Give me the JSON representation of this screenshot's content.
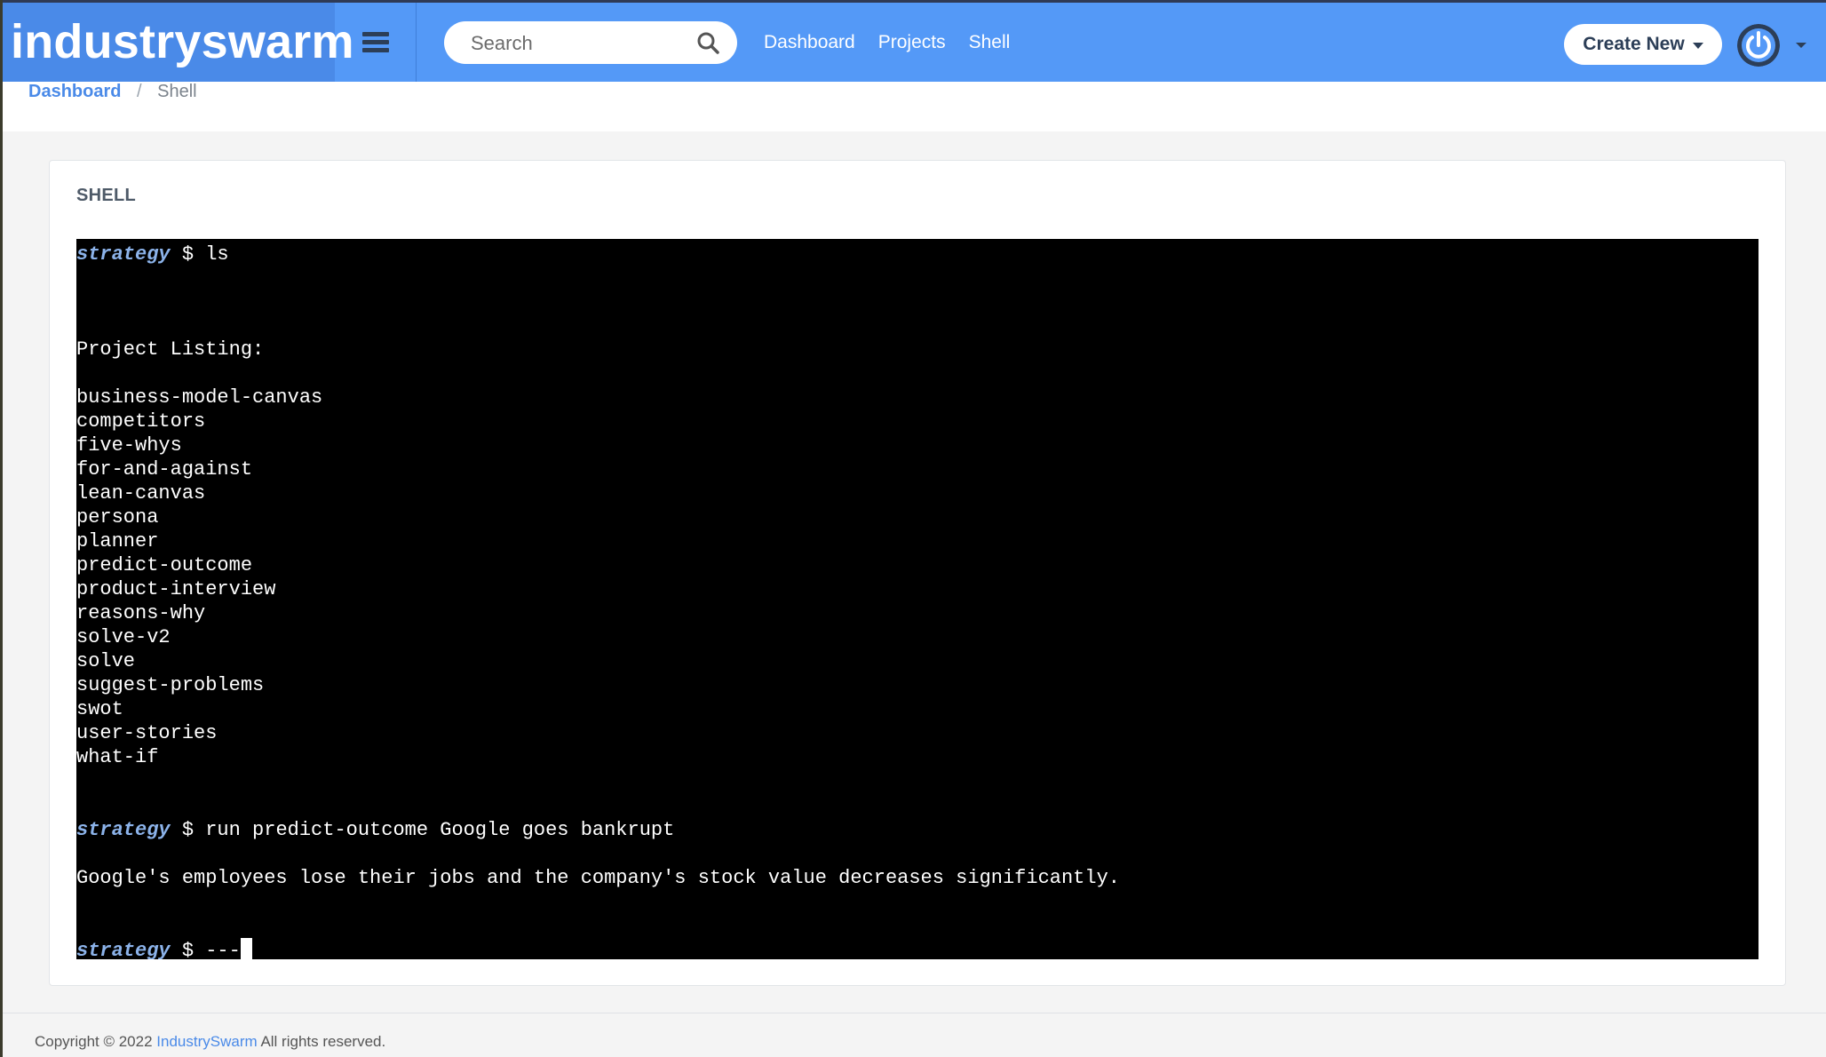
{
  "brand": "industryswarm",
  "search": {
    "placeholder": "Search"
  },
  "nav": [
    {
      "label": "Dashboard"
    },
    {
      "label": "Projects"
    },
    {
      "label": "Shell"
    }
  ],
  "create_button": "Create New",
  "breadcrumb": {
    "home": "Dashboard",
    "separator": "/",
    "current": "Shell"
  },
  "card": {
    "title": "SHELL"
  },
  "terminal": {
    "prompt": "strategy",
    "lines": [
      {
        "kind": "command",
        "text": " $ ls"
      },
      {
        "kind": "output",
        "text": "Project Listing:"
      },
      {
        "kind": "output",
        "text": "business-model-canvas"
      },
      {
        "kind": "output",
        "text": "competitors"
      },
      {
        "kind": "output",
        "text": "five-whys"
      },
      {
        "kind": "output",
        "text": "for-and-against"
      },
      {
        "kind": "output",
        "text": "lean-canvas"
      },
      {
        "kind": "output",
        "text": "persona"
      },
      {
        "kind": "output",
        "text": "planner"
      },
      {
        "kind": "output",
        "text": "predict-outcome"
      },
      {
        "kind": "output",
        "text": "product-interview"
      },
      {
        "kind": "output",
        "text": "reasons-why"
      },
      {
        "kind": "output",
        "text": "solve-v2"
      },
      {
        "kind": "output",
        "text": "solve"
      },
      {
        "kind": "output",
        "text": "suggest-problems"
      },
      {
        "kind": "output",
        "text": "swot"
      },
      {
        "kind": "output",
        "text": "user-stories"
      },
      {
        "kind": "output",
        "text": "what-if"
      },
      {
        "kind": "command",
        "text": " $ run predict-outcome Google goes bankrupt"
      },
      {
        "kind": "output",
        "text": "Google's employees lose their jobs and the company's stock value decreases significantly."
      },
      {
        "kind": "input",
        "text": " $ ---"
      }
    ]
  },
  "footer": {
    "prefix": "Copyright © 2022 ",
    "link": "IndustrySwarm",
    "suffix": " All rights reserved."
  },
  "colors": {
    "navbar": "#5499f7",
    "brand_bg": "#4a8ae8",
    "prompt": "#8cb3ea",
    "dark": "#2c3e57"
  },
  "icons": [
    "menu-icon",
    "search-icon",
    "caret-down-icon",
    "power-icon"
  ]
}
